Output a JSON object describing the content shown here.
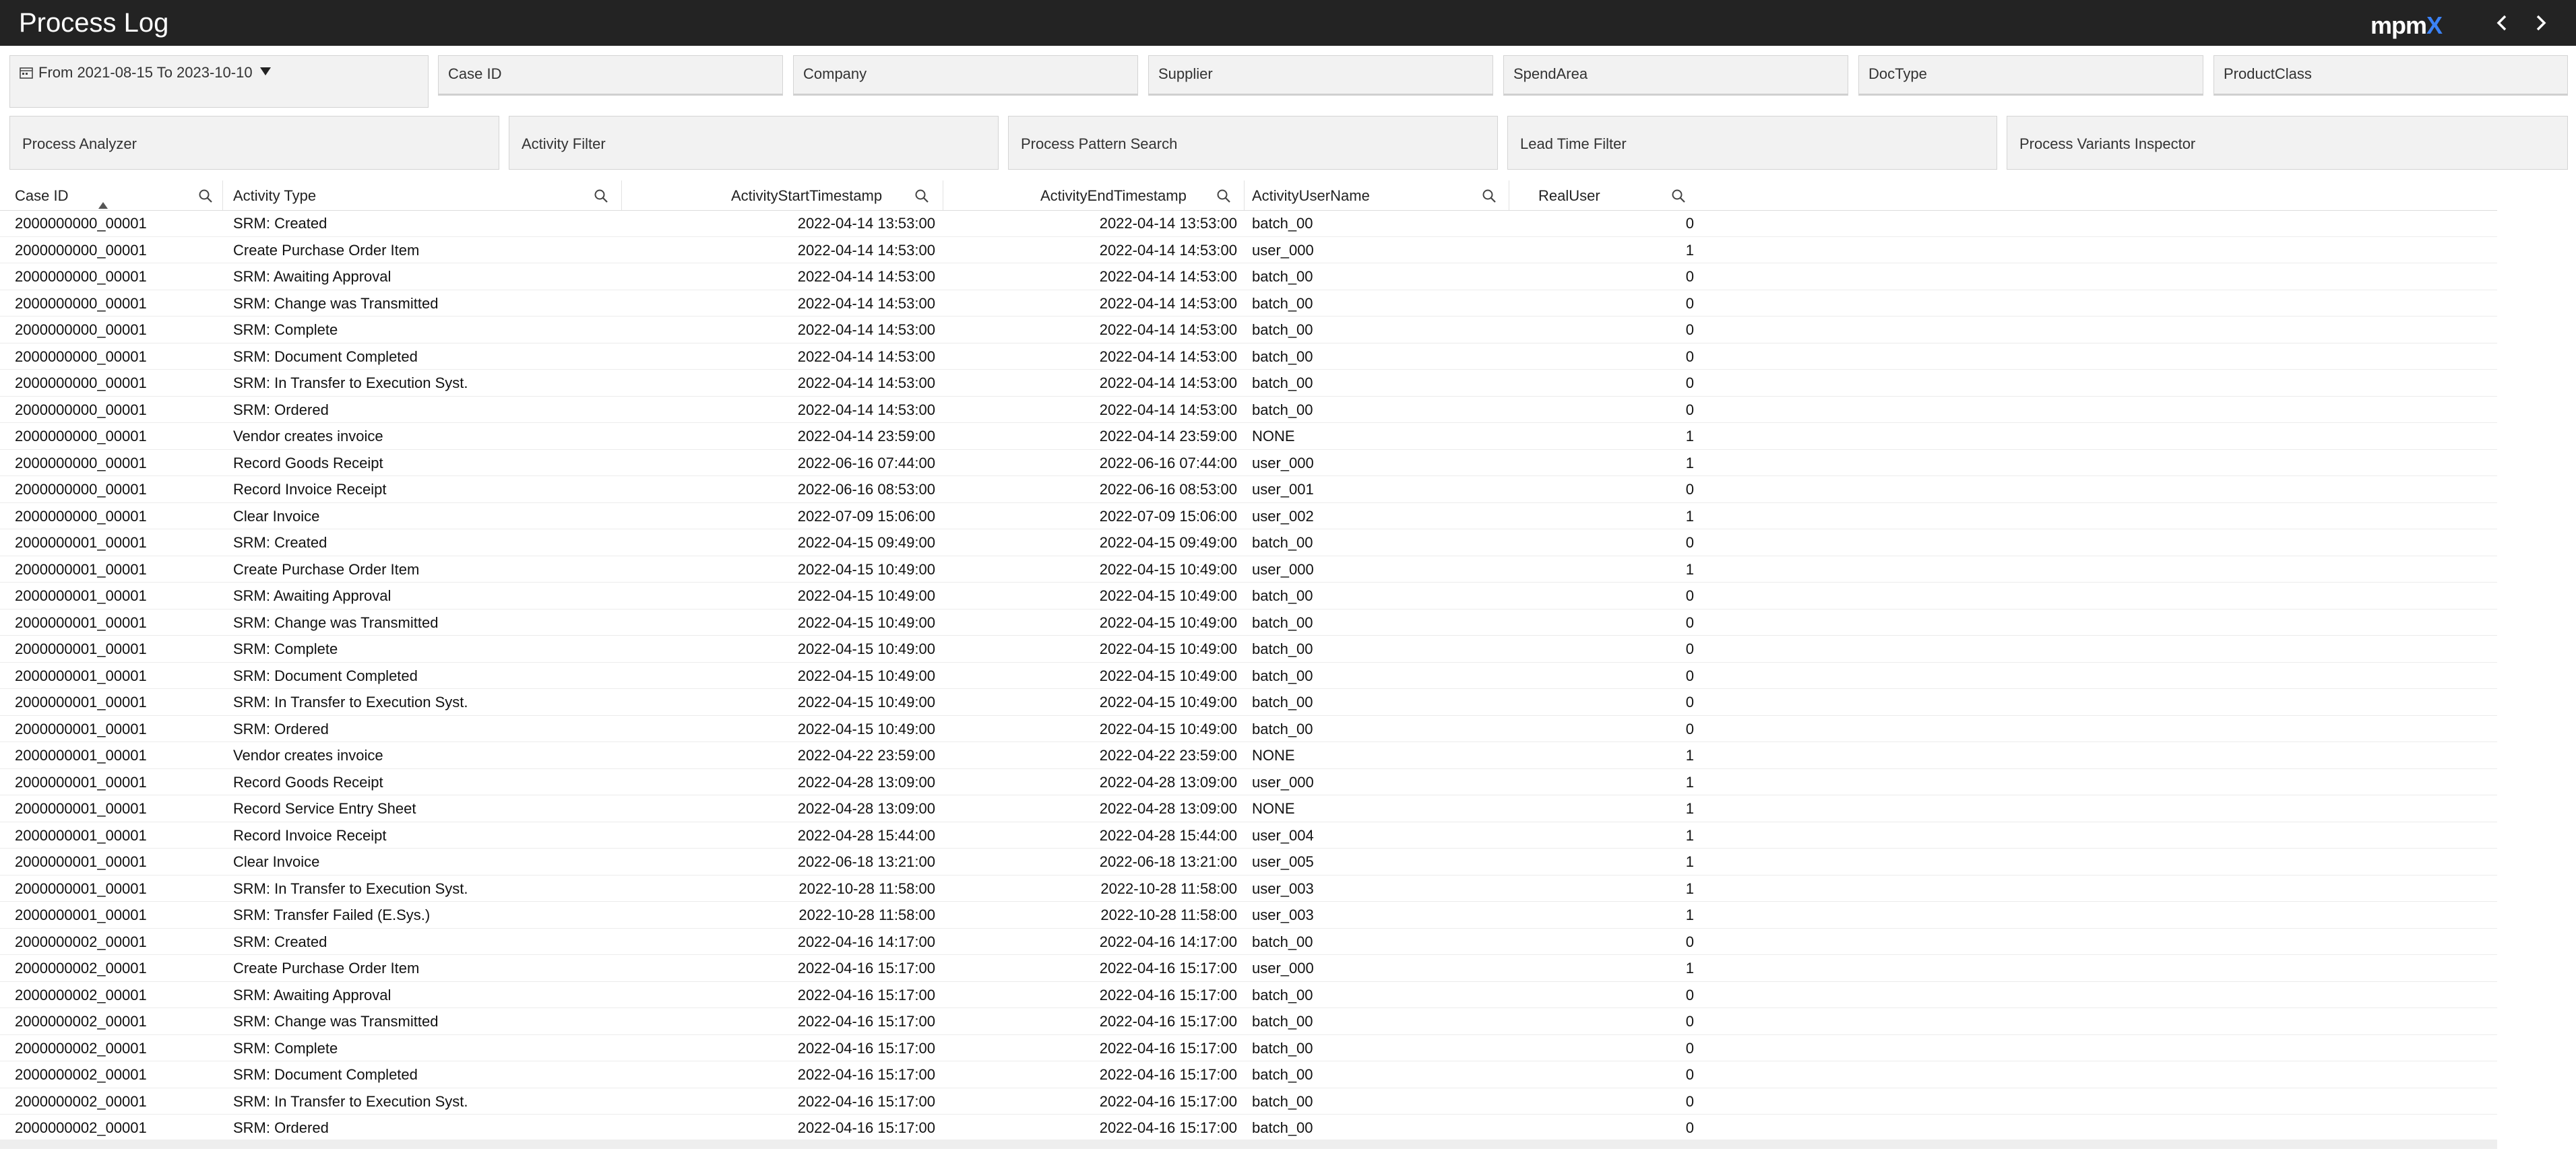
{
  "header": {
    "title": "Process Log",
    "logo_main": "mpm",
    "logo_x": "X"
  },
  "filters": {
    "date_range": "From 2021-08-15 To 2023-10-10",
    "fields": [
      "Case ID",
      "Company",
      "Supplier",
      "SpendArea",
      "DocType",
      "ProductClass"
    ]
  },
  "tools": [
    "Process Analyzer",
    "Activity Filter",
    "Process Pattern Search",
    "Lead Time Filter",
    "Process Variants Inspector"
  ],
  "table": {
    "columns": [
      "Case ID",
      "Activity Type",
      "ActivityStartTimestamp",
      "ActivityEndTimestamp",
      "ActivityUserName",
      "RealUser"
    ],
    "rows": [
      [
        "2000000000_00001",
        "SRM: Created",
        "2022-04-14 13:53:00",
        "2022-04-14 13:53:00",
        "batch_00",
        "0"
      ],
      [
        "2000000000_00001",
        "Create Purchase Order Item",
        "2022-04-14 14:53:00",
        "2022-04-14 14:53:00",
        "user_000",
        "1"
      ],
      [
        "2000000000_00001",
        "SRM: Awaiting Approval",
        "2022-04-14 14:53:00",
        "2022-04-14 14:53:00",
        "batch_00",
        "0"
      ],
      [
        "2000000000_00001",
        "SRM: Change was Transmitted",
        "2022-04-14 14:53:00",
        "2022-04-14 14:53:00",
        "batch_00",
        "0"
      ],
      [
        "2000000000_00001",
        "SRM: Complete",
        "2022-04-14 14:53:00",
        "2022-04-14 14:53:00",
        "batch_00",
        "0"
      ],
      [
        "2000000000_00001",
        "SRM: Document Completed",
        "2022-04-14 14:53:00",
        "2022-04-14 14:53:00",
        "batch_00",
        "0"
      ],
      [
        "2000000000_00001",
        "SRM: In Transfer to Execution Syst.",
        "2022-04-14 14:53:00",
        "2022-04-14 14:53:00",
        "batch_00",
        "0"
      ],
      [
        "2000000000_00001",
        "SRM: Ordered",
        "2022-04-14 14:53:00",
        "2022-04-14 14:53:00",
        "batch_00",
        "0"
      ],
      [
        "2000000000_00001",
        "Vendor creates invoice",
        "2022-04-14 23:59:00",
        "2022-04-14 23:59:00",
        "NONE",
        "1"
      ],
      [
        "2000000000_00001",
        "Record Goods Receipt",
        "2022-06-16 07:44:00",
        "2022-06-16 07:44:00",
        "user_000",
        "1"
      ],
      [
        "2000000000_00001",
        "Record Invoice Receipt",
        "2022-06-16 08:53:00",
        "2022-06-16 08:53:00",
        "user_001",
        "0"
      ],
      [
        "2000000000_00001",
        "Clear Invoice",
        "2022-07-09 15:06:00",
        "2022-07-09 15:06:00",
        "user_002",
        "1"
      ],
      [
        "2000000001_00001",
        "SRM: Created",
        "2022-04-15 09:49:00",
        "2022-04-15 09:49:00",
        "batch_00",
        "0"
      ],
      [
        "2000000001_00001",
        "Create Purchase Order Item",
        "2022-04-15 10:49:00",
        "2022-04-15 10:49:00",
        "user_000",
        "1"
      ],
      [
        "2000000001_00001",
        "SRM: Awaiting Approval",
        "2022-04-15 10:49:00",
        "2022-04-15 10:49:00",
        "batch_00",
        "0"
      ],
      [
        "2000000001_00001",
        "SRM: Change was Transmitted",
        "2022-04-15 10:49:00",
        "2022-04-15 10:49:00",
        "batch_00",
        "0"
      ],
      [
        "2000000001_00001",
        "SRM: Complete",
        "2022-04-15 10:49:00",
        "2022-04-15 10:49:00",
        "batch_00",
        "0"
      ],
      [
        "2000000001_00001",
        "SRM: Document Completed",
        "2022-04-15 10:49:00",
        "2022-04-15 10:49:00",
        "batch_00",
        "0"
      ],
      [
        "2000000001_00001",
        "SRM: In Transfer to Execution Syst.",
        "2022-04-15 10:49:00",
        "2022-04-15 10:49:00",
        "batch_00",
        "0"
      ],
      [
        "2000000001_00001",
        "SRM: Ordered",
        "2022-04-15 10:49:00",
        "2022-04-15 10:49:00",
        "batch_00",
        "0"
      ],
      [
        "2000000001_00001",
        "Vendor creates invoice",
        "2022-04-22 23:59:00",
        "2022-04-22 23:59:00",
        "NONE",
        "1"
      ],
      [
        "2000000001_00001",
        "Record Goods Receipt",
        "2022-04-28 13:09:00",
        "2022-04-28 13:09:00",
        "user_000",
        "1"
      ],
      [
        "2000000001_00001",
        "Record Service Entry Sheet",
        "2022-04-28 13:09:00",
        "2022-04-28 13:09:00",
        "NONE",
        "1"
      ],
      [
        "2000000001_00001",
        "Record Invoice Receipt",
        "2022-04-28 15:44:00",
        "2022-04-28 15:44:00",
        "user_004",
        "1"
      ],
      [
        "2000000001_00001",
        "Clear Invoice",
        "2022-06-18 13:21:00",
        "2022-06-18 13:21:00",
        "user_005",
        "1"
      ],
      [
        "2000000001_00001",
        "SRM: In Transfer to Execution Syst.",
        "2022-10-28 11:58:00",
        "2022-10-28 11:58:00",
        "user_003",
        "1"
      ],
      [
        "2000000001_00001",
        "SRM: Transfer Failed (E.Sys.)",
        "2022-10-28 11:58:00",
        "2022-10-28 11:58:00",
        "user_003",
        "1"
      ],
      [
        "2000000002_00001",
        "SRM: Created",
        "2022-04-16 14:17:00",
        "2022-04-16 14:17:00",
        "batch_00",
        "0"
      ],
      [
        "2000000002_00001",
        "Create Purchase Order Item",
        "2022-04-16 15:17:00",
        "2022-04-16 15:17:00",
        "user_000",
        "1"
      ],
      [
        "2000000002_00001",
        "SRM: Awaiting Approval",
        "2022-04-16 15:17:00",
        "2022-04-16 15:17:00",
        "batch_00",
        "0"
      ],
      [
        "2000000002_00001",
        "SRM: Change was Transmitted",
        "2022-04-16 15:17:00",
        "2022-04-16 15:17:00",
        "batch_00",
        "0"
      ],
      [
        "2000000002_00001",
        "SRM: Complete",
        "2022-04-16 15:17:00",
        "2022-04-16 15:17:00",
        "batch_00",
        "0"
      ],
      [
        "2000000002_00001",
        "SRM: Document Completed",
        "2022-04-16 15:17:00",
        "2022-04-16 15:17:00",
        "batch_00",
        "0"
      ],
      [
        "2000000002_00001",
        "SRM: In Transfer to Execution Syst.",
        "2022-04-16 15:17:00",
        "2022-04-16 15:17:00",
        "batch_00",
        "0"
      ],
      [
        "2000000002_00001",
        "SRM: Ordered",
        "2022-04-16 15:17:00",
        "2022-04-16 15:17:00",
        "batch_00",
        "0"
      ]
    ]
  }
}
